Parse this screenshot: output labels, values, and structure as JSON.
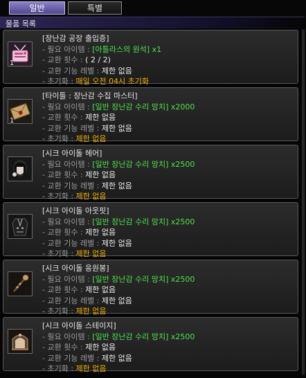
{
  "tabs": {
    "general": "일반",
    "special": "특별"
  },
  "section_title": "물품 목록",
  "labels": {
    "required_item": "- 필요 아이템 :",
    "exchange_count": "- 교환 횟수 :",
    "exchange_level": "- 교환 기능 레벨 :",
    "reset": "- 초기화 :"
  },
  "items": [
    {
      "title": "[장난감 공장 출입증]",
      "required": "[아틀라스의 원석] x1",
      "count": "( 2 / 2)",
      "level": "제한 없음",
      "reset": "매일 오전 04시 초기화",
      "qty": "1",
      "icon": "ticket-icon"
    },
    {
      "title": "[타이틀 : 장난감 수집 마스터]",
      "required": "[일반 장난감 수리 망치] x2000",
      "count": "제한 없음",
      "level": "제한 없음",
      "reset": "제한 없음",
      "qty": "1",
      "icon": "envelope-icon"
    },
    {
      "title": "[시크 아이돌 헤어]",
      "required": "[일반 장난감 수리 망치] x2500",
      "count": "제한 없음",
      "level": "제한 없음",
      "reset": "제한 없음",
      "qty": "",
      "icon": "hair-icon"
    },
    {
      "title": "[시크 아이돌 아웃핏]",
      "required": "[일반 장난감 수리 망치] x2500",
      "count": "제한 없음",
      "level": "제한 없음",
      "reset": "제한 없음",
      "qty": "",
      "icon": "outfit-icon"
    },
    {
      "title": "[시크 아이돌 응원봉]",
      "required": "[일반 장난감 수리 망치] x2500",
      "count": "제한 없음",
      "level": "제한 없음",
      "reset": "제한 없음",
      "qty": "",
      "icon": "cheer-stick-icon"
    },
    {
      "title": "[시크 아이돌 스테이지]",
      "required": "[일반 장난감 수리 망치] x2500",
      "count": "제한 없음",
      "level": "제한 없음",
      "reset": "제한 없음",
      "qty": "",
      "icon": "stage-icon"
    }
  ]
}
